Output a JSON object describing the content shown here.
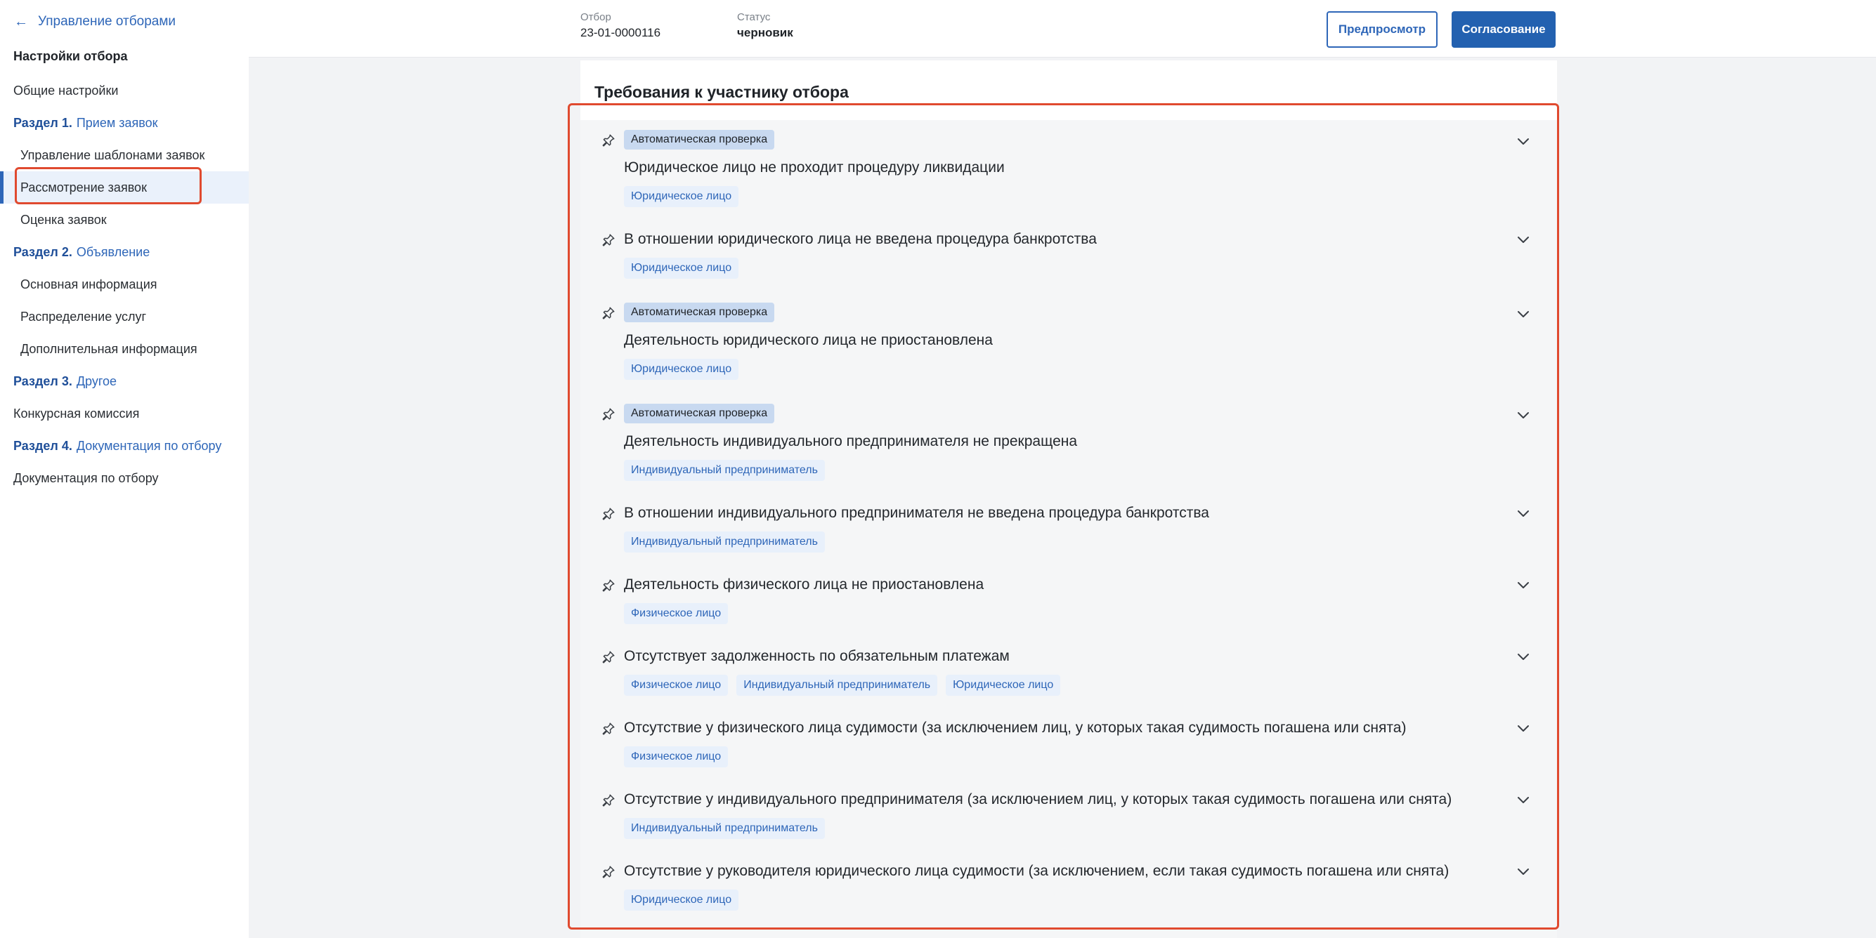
{
  "sidebar": {
    "back_label": "Управление отборами",
    "heading": "Настройки отбора",
    "items": [
      {
        "label": "Общие настройки"
      },
      {
        "num": "Раздел 1.",
        "label": "Прием заявок"
      },
      {
        "label": "Управление шаблонами заявок"
      },
      {
        "label": "Рассмотрение заявок"
      },
      {
        "label": "Оценка заявок"
      },
      {
        "num": "Раздел 2.",
        "label": "Объявление"
      },
      {
        "label": "Основная информация"
      },
      {
        "label": "Распределение услуг"
      },
      {
        "label": "Дополнительная информация"
      },
      {
        "num": "Раздел 3.",
        "label": "Другое"
      },
      {
        "label": "Конкурсная комиссия"
      },
      {
        "num": "Раздел 4.",
        "label": "Документация по отбору"
      },
      {
        "label": "Документация по отбору"
      }
    ]
  },
  "header": {
    "number_label": "Отбор",
    "number_value": "23-01-0000116",
    "status_label": "Статус",
    "status_value": "черновик",
    "preview_button": "Предпросмотр",
    "approve_button": "Согласование"
  },
  "section": {
    "title": "Требования к участнику отбора",
    "auto_check_label": "Автоматическая проверка",
    "requirements": [
      {
        "auto": true,
        "title": "Юридическое лицо не проходит процедуру ликвидации",
        "tags": [
          "Юридическое лицо"
        ]
      },
      {
        "auto": false,
        "title": "В отношении юридического лица не введена процедура банкротства",
        "tags": [
          "Юридическое лицо"
        ]
      },
      {
        "auto": true,
        "title": "Деятельность юридического лица не приостановлена",
        "tags": [
          "Юридическое лицо"
        ]
      },
      {
        "auto": true,
        "title": "Деятельность индивидуального предпринимателя не прекращена",
        "tags": [
          "Индивидуальный предприниматель"
        ]
      },
      {
        "auto": false,
        "title": "В отношении индивидуального предпринимателя не введена процедура банкротства",
        "tags": [
          "Индивидуальный предприниматель"
        ]
      },
      {
        "auto": false,
        "title": "Деятельность физического лица не приостановлена",
        "tags": [
          "Физическое лицо"
        ]
      },
      {
        "auto": false,
        "title": "Отсутствует задолженность по обязательным платежам",
        "tags": [
          "Физическое лицо",
          "Индивидуальный предприниматель",
          "Юридическое лицо"
        ]
      },
      {
        "auto": false,
        "title": "Отсутствие у физического лица судимости (за исключением лиц, у которых такая судимость погашена или снята)",
        "tags": [
          "Физическое лицо"
        ]
      },
      {
        "auto": false,
        "title": "Отсутствие у индивидуального предпринимателя (за исключением лиц, у которых такая судимость погашена или снята)",
        "tags": [
          "Индивидуальный предприниматель"
        ]
      },
      {
        "auto": false,
        "title": "Отсутствие у руководителя юридического лица судимости (за исключением, если такая судимость погашена или снята)",
        "tags": [
          "Юридическое лицо"
        ]
      }
    ]
  },
  "colors": {
    "accent": "#2e66b8",
    "highlight_border": "#e04a2f",
    "badge_auto_bg": "#c8d9f0",
    "tag_bg": "#e8f0fb"
  },
  "icons": {
    "back": "arrow-left-icon",
    "pin": "pin-icon",
    "expand": "chevron-down-icon"
  }
}
